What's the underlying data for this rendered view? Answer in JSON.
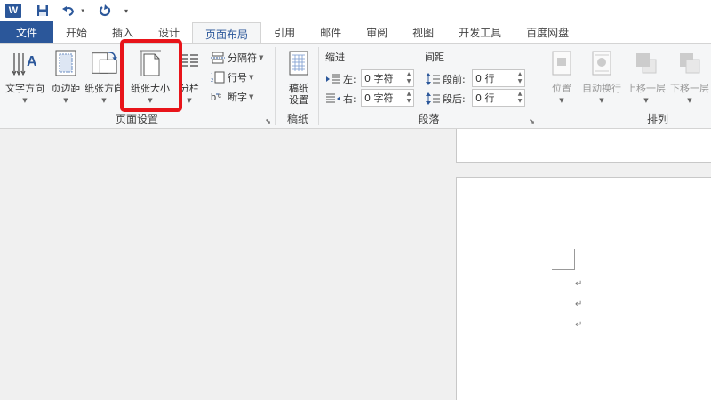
{
  "qat": {
    "logo_letter": "W",
    "save_icon": "save-icon",
    "undo_icon": "undo-icon",
    "redo_icon": "redo-icon"
  },
  "tabs": [
    {
      "id": "file",
      "label": "文件"
    },
    {
      "id": "home",
      "label": "开始"
    },
    {
      "id": "insert",
      "label": "插入"
    },
    {
      "id": "design",
      "label": "设计"
    },
    {
      "id": "layout",
      "label": "页面布局"
    },
    {
      "id": "references",
      "label": "引用"
    },
    {
      "id": "mailings",
      "label": "邮件"
    },
    {
      "id": "review",
      "label": "审阅"
    },
    {
      "id": "view",
      "label": "视图"
    },
    {
      "id": "developer",
      "label": "开发工具"
    },
    {
      "id": "baidu",
      "label": "百度网盘"
    }
  ],
  "ribbon": {
    "page_setup": {
      "label": "页面设置",
      "text_direction": "文字方向",
      "margins": "页边距",
      "orientation": "纸张方向",
      "size": "纸张大小",
      "columns": "分栏",
      "breaks": "分隔符",
      "line_numbers": "行号",
      "hyphenation": "断字"
    },
    "manuscript": {
      "label": "稿纸",
      "button_line1": "稿纸",
      "button_line2": "设置"
    },
    "paragraph": {
      "label": "段落",
      "indent_label": "缩进",
      "spacing_label": "间距",
      "left_label": "左:",
      "right_label": "右:",
      "before_label": "段前:",
      "after_label": "段后:",
      "left_value": "0 字符",
      "right_value": "0 字符",
      "before_value": "0 行",
      "after_value": "0 行"
    },
    "arrange": {
      "label": "排列",
      "position": "位置",
      "wrap_text": "自动换行",
      "bring_forward": "上移一层",
      "send_backward": "下移一层"
    }
  },
  "document": {
    "paragraph_mark": "↵"
  }
}
